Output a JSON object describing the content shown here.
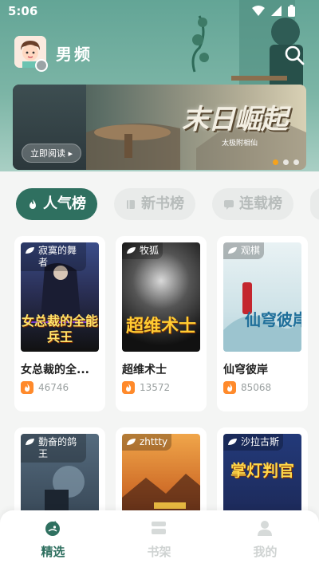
{
  "status_bar": {
    "time": "5:06"
  },
  "header": {
    "channel": "男频"
  },
  "banner": {
    "title": "末日崛起",
    "subtitle": "太极附相仙",
    "read_button": "立即阅读 ▸",
    "slide_count": 3,
    "active_slide": 1
  },
  "tabs": [
    {
      "label": "人气榜",
      "active": true
    },
    {
      "label": "新书榜",
      "active": false
    },
    {
      "label": "连载榜",
      "active": false
    }
  ],
  "books": [
    {
      "author": "寂寞的舞者",
      "cover_text": "女总裁的全能兵王",
      "title": "女总裁的全...",
      "heat": "46746"
    },
    {
      "author": "牧狐",
      "cover_text": "超维术士",
      "title": "超维术士",
      "heat": "13572"
    },
    {
      "author": "观棋",
      "cover_text": "仙穹彼岸",
      "title": "仙穹彼岸",
      "heat": "85068"
    },
    {
      "author": "勤奋的鸽王",
      "cover_text": "",
      "title": "",
      "heat": ""
    },
    {
      "author": "zhttty",
      "cover_text": "",
      "title": "",
      "heat": ""
    },
    {
      "author": "沙拉古斯",
      "cover_text": "掌灯判官",
      "title": "",
      "heat": ""
    }
  ],
  "bottom_nav": [
    {
      "label": "精选",
      "icon": "featured-icon",
      "active": true
    },
    {
      "label": "书架",
      "icon": "bookshelf-icon",
      "active": false
    },
    {
      "label": "我的",
      "icon": "profile-icon",
      "active": false
    }
  ],
  "colors": {
    "accent": "#2f7060",
    "header": "#63a596",
    "heat": "#ff8a2b",
    "dot_active": "#f6a21c"
  }
}
